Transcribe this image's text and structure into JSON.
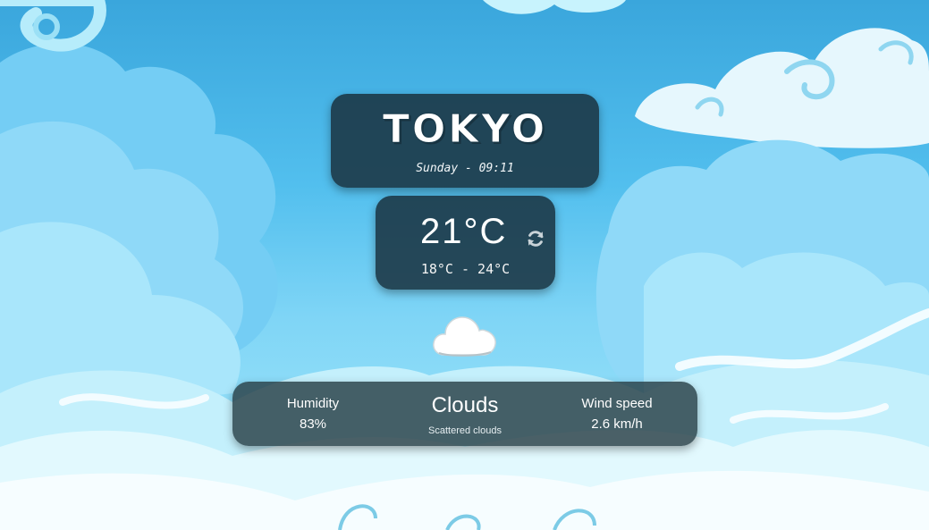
{
  "city": {
    "name": "TOKYO",
    "day_time": "Sunday - 09:11"
  },
  "temperature": {
    "current": "21°C",
    "range": "18°C - 24°C",
    "refresh_icon": "refresh-icon"
  },
  "weather": {
    "icon": "cloud-icon",
    "condition": "Clouds",
    "description": "Scattered clouds"
  },
  "details": {
    "humidity_label": "Humidity",
    "humidity_value": "83%",
    "wind_label": "Wind speed",
    "wind_value": "2.6 km/h"
  },
  "colors": {
    "sky": "#3aa6dc",
    "card": "#1a3442",
    "cloud": "#ffffff"
  }
}
